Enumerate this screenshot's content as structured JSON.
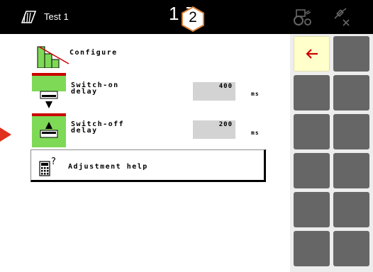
{
  "topbar": {
    "title": "Test 1",
    "clock": "1   7",
    "callout_number": "2",
    "icons": [
      "field-book-icon",
      "tractor-icon",
      "gps-disconnected-icon"
    ]
  },
  "menu": {
    "configure": {
      "label": "Configure"
    },
    "switch_on": {
      "label_line1": "Switch-on",
      "label_line2": "delay",
      "value": "400",
      "unit": "ms"
    },
    "switch_off": {
      "label_line1": "Switch-off",
      "label_line2": "delay",
      "value": "200",
      "unit": "ms"
    },
    "adjustment_help": {
      "label": "Adjustment help"
    }
  },
  "softkeys": {
    "back": {
      "icon": "back-arrow-icon"
    }
  },
  "colors": {
    "accent_green": "#7ed957",
    "header_black": "#000000",
    "softkey_gray": "#666666",
    "softkey_active": "#ffffcc",
    "back_arrow_red": "#cc0000",
    "marker_red": "#e0301e",
    "callout_orange": "#d9823b"
  }
}
